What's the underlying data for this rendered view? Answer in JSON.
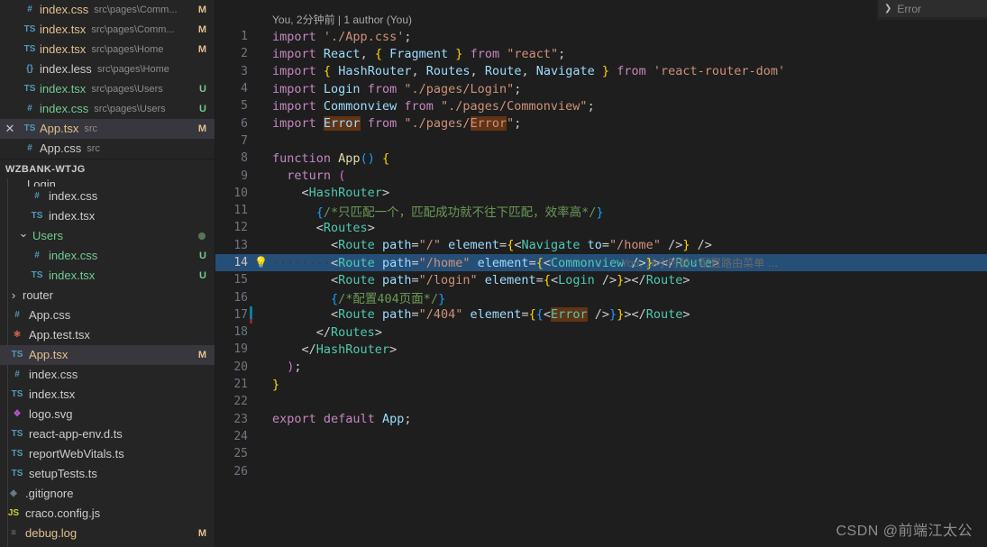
{
  "window": {
    "background": "#1e1e1e",
    "sidebar_background": "#252526",
    "accent_selection": "#264f78"
  },
  "tabbar": {
    "partial_tab_label": "Error",
    "chevron_icon": "chevron-right"
  },
  "open_editors": [
    {
      "icon": "css-file-icon",
      "name": "index.css",
      "path": "src\\pages\\Comm...",
      "badge": "M",
      "badge_kind": "modified",
      "selected": false,
      "name_color": "modified"
    },
    {
      "icon": "typescript-file-icon",
      "name": "index.tsx",
      "path": "src\\pages\\Comm...",
      "badge": "M",
      "badge_kind": "modified",
      "selected": false,
      "name_color": "modified"
    },
    {
      "icon": "typescript-file-icon",
      "name": "index.tsx",
      "path": "src\\pages\\Home",
      "badge": "M",
      "badge_kind": "modified",
      "selected": false,
      "name_color": "modified"
    },
    {
      "icon": "less-file-icon",
      "name": "index.less",
      "path": "src\\pages\\Home",
      "badge": "",
      "badge_kind": "",
      "selected": false,
      "name_color": "default"
    },
    {
      "icon": "typescript-file-icon",
      "name": "index.tsx",
      "path": "src\\pages\\Users",
      "badge": "U",
      "badge_kind": "untracked",
      "selected": false,
      "name_color": "untracked"
    },
    {
      "icon": "css-file-icon",
      "name": "index.css",
      "path": "src\\pages\\Users",
      "badge": "U",
      "badge_kind": "untracked",
      "selected": false,
      "name_color": "untracked"
    },
    {
      "icon": "typescript-file-icon",
      "name": "App.tsx",
      "path": "src",
      "badge": "M",
      "badge_kind": "modified",
      "selected": true,
      "name_color": "modified",
      "close_icon": "close-icon"
    },
    {
      "icon": "css-file-icon",
      "name": "App.css",
      "path": "src",
      "badge": "",
      "badge_kind": "",
      "selected": false,
      "name_color": "default"
    }
  ],
  "explorer": {
    "header": "WZBANK-WTJG",
    "clipped_item": "Login",
    "items": [
      {
        "icon": "css-file-icon",
        "name": "index.css",
        "badge": "",
        "badge_kind": "",
        "indent": 2,
        "kind": "file",
        "name_color": "default"
      },
      {
        "icon": "typescript-file-icon",
        "name": "index.tsx",
        "badge": "",
        "badge_kind": "",
        "indent": 2,
        "kind": "file",
        "name_color": "default"
      },
      {
        "icon": "chevron-down-icon",
        "name": "Users",
        "badge": "",
        "badge_kind": "dot",
        "indent": 1,
        "kind": "folder-open",
        "name_color": "untracked"
      },
      {
        "icon": "css-file-icon",
        "name": "index.css",
        "badge": "U",
        "badge_kind": "untracked",
        "indent": 2,
        "kind": "file",
        "name_color": "untracked"
      },
      {
        "icon": "typescript-file-icon",
        "name": "index.tsx",
        "badge": "U",
        "badge_kind": "untracked",
        "indent": 2,
        "kind": "file",
        "name_color": "untracked"
      },
      {
        "icon": "chevron-right-icon",
        "name": "router",
        "badge": "",
        "badge_kind": "",
        "indent": 0,
        "kind": "folder",
        "name_color": "default"
      },
      {
        "icon": "css-file-icon",
        "name": "App.css",
        "badge": "",
        "badge_kind": "",
        "indent": 0,
        "kind": "file",
        "name_color": "default"
      },
      {
        "icon": "react-file-icon",
        "name": "App.test.tsx",
        "badge": "",
        "badge_kind": "",
        "indent": 0,
        "kind": "file",
        "name_color": "default"
      },
      {
        "icon": "typescript-file-icon",
        "name": "App.tsx",
        "badge": "M",
        "badge_kind": "modified",
        "indent": 0,
        "kind": "file",
        "name_color": "modified",
        "selected": true
      },
      {
        "icon": "css-file-icon",
        "name": "index.css",
        "badge": "",
        "badge_kind": "",
        "indent": 0,
        "kind": "file",
        "name_color": "default"
      },
      {
        "icon": "typescript-file-icon",
        "name": "index.tsx",
        "badge": "",
        "badge_kind": "",
        "indent": 0,
        "kind": "file",
        "name_color": "default"
      },
      {
        "icon": "svg-file-icon",
        "name": "logo.svg",
        "badge": "",
        "badge_kind": "",
        "indent": 0,
        "kind": "file",
        "name_color": "default"
      },
      {
        "icon": "typescript-file-icon",
        "name": "react-app-env.d.ts",
        "badge": "",
        "badge_kind": "",
        "indent": 0,
        "kind": "file",
        "name_color": "default"
      },
      {
        "icon": "typescript-file-icon",
        "name": "reportWebVitals.ts",
        "badge": "",
        "badge_kind": "",
        "indent": 0,
        "kind": "file",
        "name_color": "default"
      },
      {
        "icon": "typescript-file-icon",
        "name": "setupTests.ts",
        "badge": "",
        "badge_kind": "",
        "indent": 0,
        "kind": "file",
        "name_color": "default"
      },
      {
        "icon": "git-file-icon",
        "name": ".gitignore",
        "badge": "",
        "badge_kind": "",
        "indent": -1,
        "kind": "file",
        "name_color": "default"
      },
      {
        "icon": "javascript-file-icon",
        "name": "craco.config.js",
        "badge": "",
        "badge_kind": "",
        "indent": -1,
        "kind": "file",
        "name_color": "default"
      },
      {
        "icon": "log-file-icon",
        "name": "debug.log",
        "badge": "M",
        "badge_kind": "modified",
        "indent": -1,
        "kind": "file",
        "name_color": "modified"
      }
    ]
  },
  "editor": {
    "blame_header": "You, 2分钟前 | 1 author (You)",
    "inline_blame": "You, 18小时前 • 配置路由菜单 …",
    "inline_blame_line": 14,
    "highlighted_line": 14,
    "lightbulb_icon": "lightbulb-icon",
    "line_numbers": [
      1,
      2,
      3,
      4,
      5,
      6,
      7,
      8,
      9,
      10,
      11,
      12,
      13,
      14,
      15,
      16,
      17,
      18,
      19,
      20,
      21,
      22,
      23,
      24,
      25,
      26
    ],
    "lines": [
      "import './App.css';",
      "import React, { Fragment } from \"react\";",
      "import { HashRouter, Routes, Route, Navigate } from 'react-router-dom'",
      "import Login from \"./pages/Login\";",
      "import Commonview from \"./pages/Commonview\";",
      "import Error from \"./pages/Error\";",
      "",
      "function App() {",
      "  return (",
      "    <HashRouter>",
      "      {/*只匹配一个，匹配成功就不往下匹配，效率高*/}",
      "      <Routes>",
      "        <Route path=\"/\" element={<Navigate to=\"/home\" />} />",
      "        <Route path=\"/home\" element={<Commonview />}></Route>",
      "        <Route path=\"/login\" element={<Login />}></Route>",
      "        {/*配置404页面*/}",
      "        <Route path=\"/404\" element={{<Error />}}></Route>",
      "      </Routes>",
      "    </HashRouter>",
      "  );",
      "}",
      "",
      "export default App;",
      "",
      "",
      ""
    ]
  },
  "watermark": "CSDN @前端江太公"
}
